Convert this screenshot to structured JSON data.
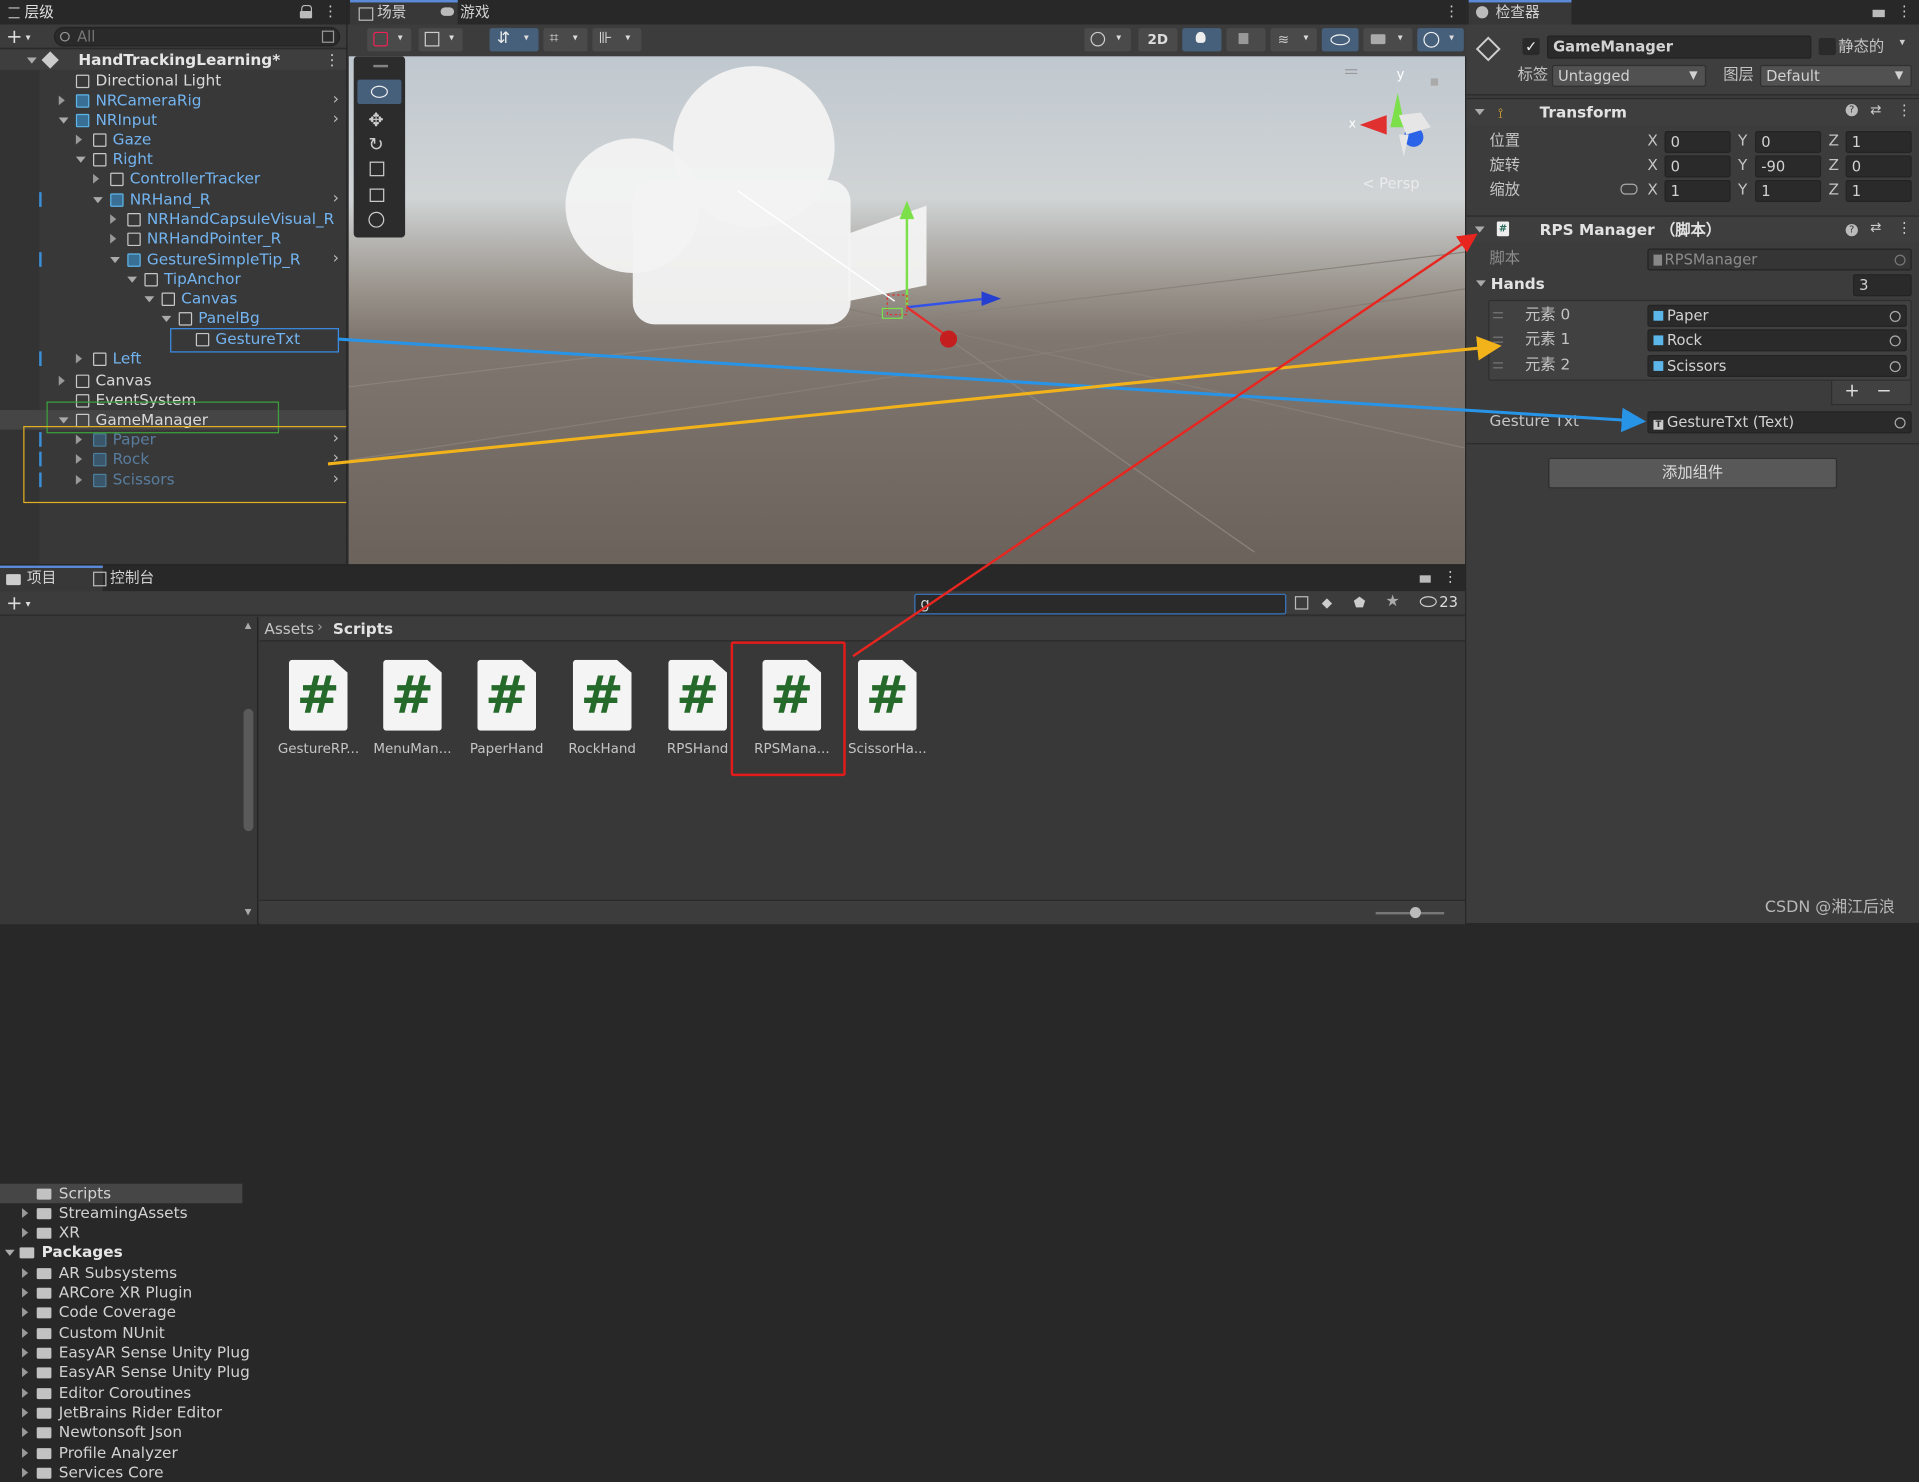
{
  "hierarchy": {
    "tab": "层级",
    "search_placeholder": "All",
    "scene": "HandTrackingLearning*",
    "items": [
      {
        "label": "Directional Light"
      },
      {
        "label": "NRCameraRig"
      },
      {
        "label": "NRInput"
      },
      {
        "label": "Gaze"
      },
      {
        "label": "Right"
      },
      {
        "label": "ControllerTracker"
      },
      {
        "label": "NRHand_R"
      },
      {
        "label": "NRHandCapsuleVisual_R"
      },
      {
        "label": "NRHandPointer_R"
      },
      {
        "label": "GestureSimpleTip_R"
      },
      {
        "label": "TipAnchor"
      },
      {
        "label": "Canvas"
      },
      {
        "label": "PanelBg"
      },
      {
        "label": "GestureTxt"
      },
      {
        "label": "Left"
      },
      {
        "label": "Canvas"
      },
      {
        "label": "EventSystem"
      },
      {
        "label": "GameManager"
      },
      {
        "label": "Paper"
      },
      {
        "label": "Rock"
      },
      {
        "label": "Scissors"
      }
    ]
  },
  "scene_view": {
    "tab_scene": "场景",
    "tab_game": "游戏",
    "btn_2d": "2D",
    "persp": "< Persp",
    "gizmo_x": "x",
    "gizmo_y": "y"
  },
  "inspector": {
    "tab": "检查器",
    "object_name": "GameManager",
    "static_label": "静态的",
    "tag_label": "标签",
    "tag_value": "Untagged",
    "layer_label": "图层",
    "layer_value": "Default",
    "transform": {
      "title": "Transform",
      "position_label": "位置",
      "rotation_label": "旋转",
      "scale_label": "缩放",
      "position": [
        "0",
        "0",
        "1"
      ],
      "rotation": [
        "0",
        "-90",
        "0"
      ],
      "scale": [
        "1",
        "1",
        "1"
      ],
      "axis_x": "X",
      "axis_y": "Y",
      "axis_z": "Z"
    },
    "component": {
      "title": "RPS Manager （脚本）",
      "script_label": "脚本",
      "script_value": "RPSManager",
      "hands_label": "Hands",
      "hands_count": "3",
      "elements": [
        {
          "label": "元素 0",
          "value": "Paper"
        },
        {
          "label": "元素 1",
          "value": "Rock"
        },
        {
          "label": "元素 2",
          "value": "Scissors"
        }
      ],
      "plus": "+",
      "minus": "−",
      "gesture_label": "Gesture Txt",
      "gesture_value": "GestureTxt (Text)"
    },
    "add_component": "添加组件"
  },
  "project": {
    "tab_project": "项目",
    "tab_console": "控制台",
    "search_value": "g",
    "hidden_count": "23",
    "breadcrumb_root": "Assets",
    "breadcrumb_current": "Scripts",
    "tree": [
      {
        "label": "Scripts"
      },
      {
        "label": "StreamingAssets"
      },
      {
        "label": "XR"
      },
      {
        "label": "Packages"
      },
      {
        "label": "AR Subsystems"
      },
      {
        "label": "ARCore XR Plugin"
      },
      {
        "label": "Code Coverage"
      },
      {
        "label": "Custom NUnit"
      },
      {
        "label": "EasyAR Sense Unity Plug"
      },
      {
        "label": "EasyAR Sense Unity Plug"
      },
      {
        "label": "Editor Coroutines"
      },
      {
        "label": "JetBrains Rider Editor"
      },
      {
        "label": "Newtonsoft Json"
      },
      {
        "label": "Profile Analyzer"
      },
      {
        "label": "Services Core"
      }
    ],
    "assets": [
      {
        "name": "GestureRP..."
      },
      {
        "name": "MenuMan..."
      },
      {
        "name": "PaperHand"
      },
      {
        "name": "RockHand"
      },
      {
        "name": "RPSHand"
      },
      {
        "name": "RPSMana..."
      },
      {
        "name": "ScissorHa..."
      }
    ],
    "hash": "#"
  },
  "watermark": "CSDN @湘江后浪"
}
